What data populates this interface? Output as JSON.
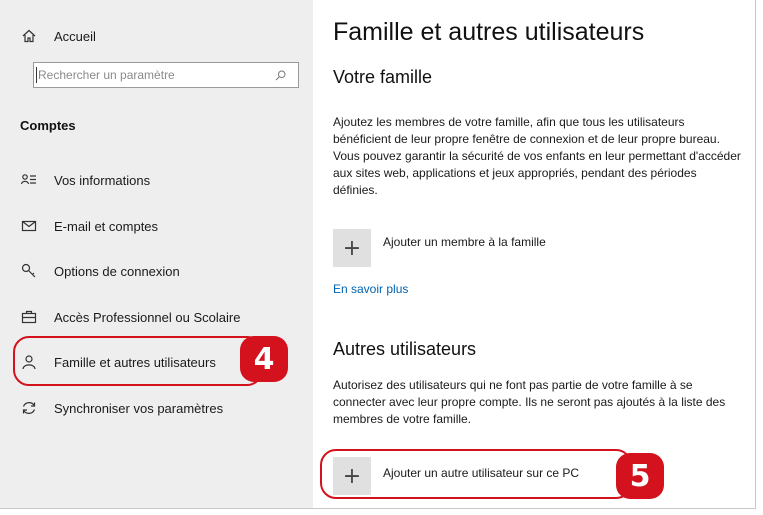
{
  "sidebar": {
    "home_label": "Accueil",
    "search_placeholder": "Rechercher un paramètre",
    "section_title": "Comptes",
    "items": [
      {
        "label": "Vos informations",
        "icon": "person-info-icon"
      },
      {
        "label": "E-mail et comptes",
        "icon": "mail-icon"
      },
      {
        "label": "Options de connexion",
        "icon": "key-icon"
      },
      {
        "label": "Accès Professionnel ou Scolaire",
        "icon": "briefcase-icon"
      },
      {
        "label": "Famille et autres utilisateurs",
        "icon": "person-icon"
      },
      {
        "label": "Synchroniser vos paramètres",
        "icon": "sync-icon"
      }
    ]
  },
  "main": {
    "title": "Famille et autres utilisateurs",
    "family": {
      "heading": "Votre famille",
      "description": "Ajoutez les membres de votre famille, afin que tous les utilisateurs bénéficient de leur propre fenêtre de connexion et de leur propre bureau. Vous pouvez garantir la sécurité de vos enfants en leur permettant d'accéder aux sites web, applications et jeux appropriés, pendant des périodes définies.",
      "add_label": "Ajouter un membre à la famille",
      "learn_more": "En savoir plus"
    },
    "others": {
      "heading": "Autres utilisateurs",
      "description": "Autorisez des utilisateurs qui ne font pas partie de votre famille à se connecter avec leur propre compte. Ils ne seront pas ajoutés à la liste des membres de votre famille.",
      "add_label": "Ajouter un autre utilisateur sur ce PC"
    }
  },
  "annotations": {
    "step4": "4",
    "step5": "5",
    "color": "#d4121d"
  }
}
